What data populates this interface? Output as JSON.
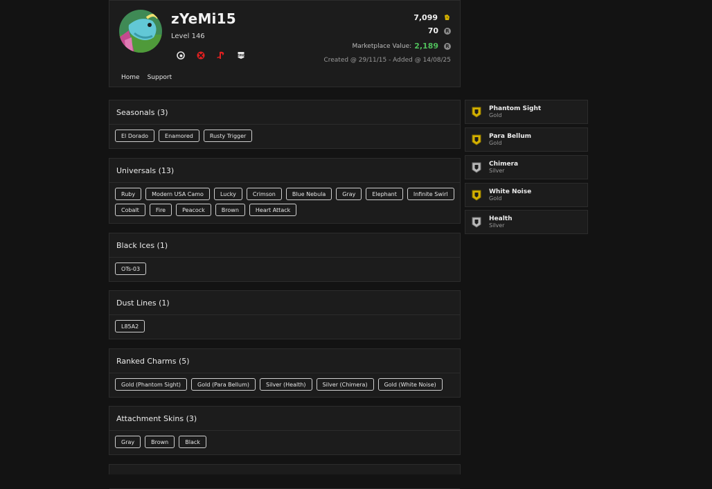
{
  "profile": {
    "username": "zYeMi15",
    "level": "Level 146",
    "credits": "7,099",
    "renown": "70",
    "marketplace_label": "Marketplace Value:",
    "marketplace_value": "2,189",
    "created": "Created @ 29/11/15 - Added @ 14/08/25",
    "platforms": [
      "ubisoft-icon",
      "xbox-icon",
      "playstation-icon",
      "epic-games-icon"
    ],
    "nav": [
      "Home",
      "Support"
    ]
  },
  "colors": {
    "accent_green": "#4fbf5b",
    "gold": "#d4b100",
    "silver": "#b9b9b9"
  },
  "sections": [
    {
      "title": "Seasonals (3)",
      "items": [
        "El Dorado",
        "Enamored",
        "Rusty Trigger"
      ]
    },
    {
      "title": "Universals (13)",
      "items": [
        "Ruby",
        "Modern USA Camo",
        "Lucky",
        "Crimson",
        "Blue Nebula",
        "Gray",
        "Elephant",
        "Infinite Swirl",
        "Cobalt",
        "Fire",
        "Peacock",
        "Brown",
        "Heart Attack"
      ]
    },
    {
      "title": "Black Ices (1)",
      "items": [
        "OTs-03"
      ]
    },
    {
      "title": "Dust Lines (1)",
      "items": [
        "L85A2"
      ]
    },
    {
      "title": "Ranked Charms (5)",
      "items": [
        "Gold (Phantom Sight)",
        "Gold (Para Bellum)",
        "Silver (Health)",
        "Silver (Chimera)",
        "Gold (White Noise)"
      ]
    },
    {
      "title": "Attachment Skins (3)",
      "items": [
        "Gray",
        "Brown",
        "Black"
      ]
    },
    {
      "title": "",
      "items": []
    }
  ],
  "ranks": [
    {
      "name": "Phantom Sight",
      "tier": "Gold"
    },
    {
      "name": "Para Bellum",
      "tier": "Gold"
    },
    {
      "name": "Chimera",
      "tier": "Silver"
    },
    {
      "name": "White Noise",
      "tier": "Gold"
    },
    {
      "name": "Health",
      "tier": "Silver"
    }
  ]
}
